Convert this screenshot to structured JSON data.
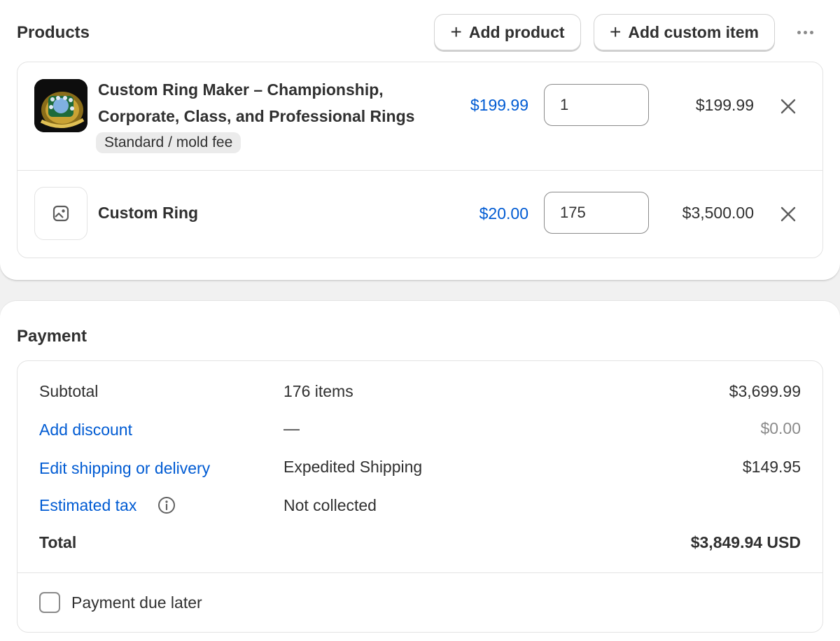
{
  "products": {
    "title": "Products",
    "add_product_label": "Add product",
    "add_custom_item_label": "Add custom item",
    "items": [
      {
        "title_line1": "Custom Ring Maker – Championship,",
        "title_line2": "Corporate, Class, and Professional Rings",
        "variant": "Standard / mold fee",
        "price": "$199.99",
        "quantity": "1",
        "line_total": "$199.99",
        "thumbnail": "ring-product-image"
      },
      {
        "title": "Custom Ring",
        "price": "$20.00",
        "quantity": "175",
        "line_total": "$3,500.00",
        "thumbnail": "image-placeholder-icon"
      }
    ]
  },
  "payment": {
    "title": "Payment",
    "rows": [
      {
        "label": "Subtotal",
        "detail": "176 items",
        "amount": "$3,699.99"
      },
      {
        "label": "Add discount",
        "detail": "—",
        "amount": "$0.00"
      },
      {
        "label": "Edit shipping or delivery",
        "detail": "Expedited Shipping",
        "amount": "$149.95"
      },
      {
        "label": "Estimated tax",
        "detail": "Not collected",
        "amount": ""
      },
      {
        "label": "Total",
        "detail": "",
        "amount": "$3,849.94 USD"
      }
    ],
    "payment_due_later_label": "Payment due later",
    "payment_due_later_checked": false
  },
  "colors": {
    "link": "#005bd3",
    "text": "#303030",
    "muted": "#8a8a8a",
    "border": "#e3e3e3",
    "background": "#f1f1f1"
  }
}
